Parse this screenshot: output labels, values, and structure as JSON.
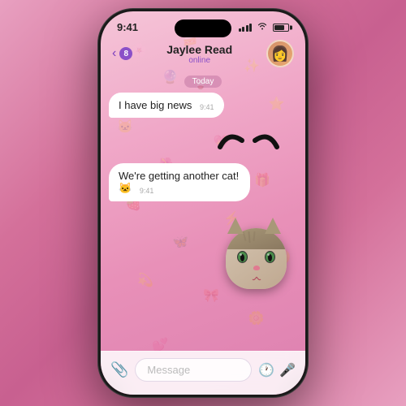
{
  "phone": {
    "status_bar": {
      "time": "9:41",
      "signal_bars": [
        3,
        5,
        7,
        9,
        11
      ],
      "battery_percent": 75
    },
    "nav": {
      "back_count": "8",
      "contact_name": "Jaylee Read",
      "contact_status": "online",
      "avatar_emoji": "👩"
    },
    "date_label": "Today",
    "messages": [
      {
        "id": "msg1",
        "type": "incoming",
        "text": "I have big news",
        "time": "9:41"
      },
      {
        "id": "msg2",
        "type": "incoming",
        "text": "We're getting another cat! 🐱",
        "time": "9:41"
      }
    ],
    "input": {
      "placeholder": "Message"
    }
  }
}
